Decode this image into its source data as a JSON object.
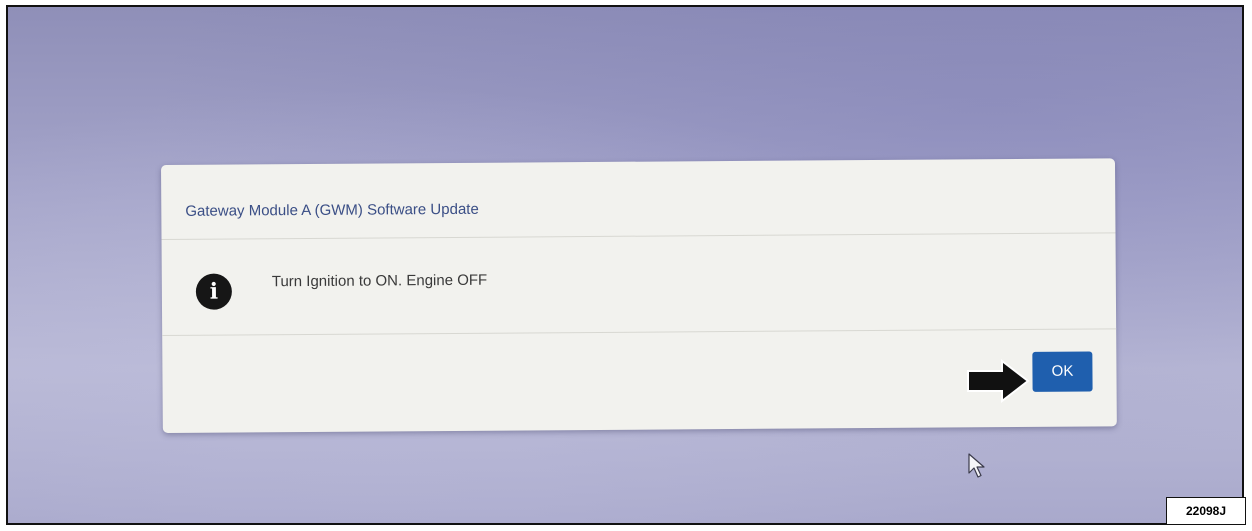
{
  "dialog": {
    "title": "Gateway Module A (GWM) Software Update",
    "message": "Turn Ignition to ON. Engine OFF",
    "icon": "info-icon",
    "ok_label": "OK"
  },
  "annotations": {
    "figure_id": "22098J",
    "pointer": "arrow-right-icon",
    "cursor": "mouse-cursor-icon"
  },
  "colors": {
    "button": "#1f5fae",
    "title": "#3b4f86",
    "dialog_bg": "#f2f2ee"
  }
}
